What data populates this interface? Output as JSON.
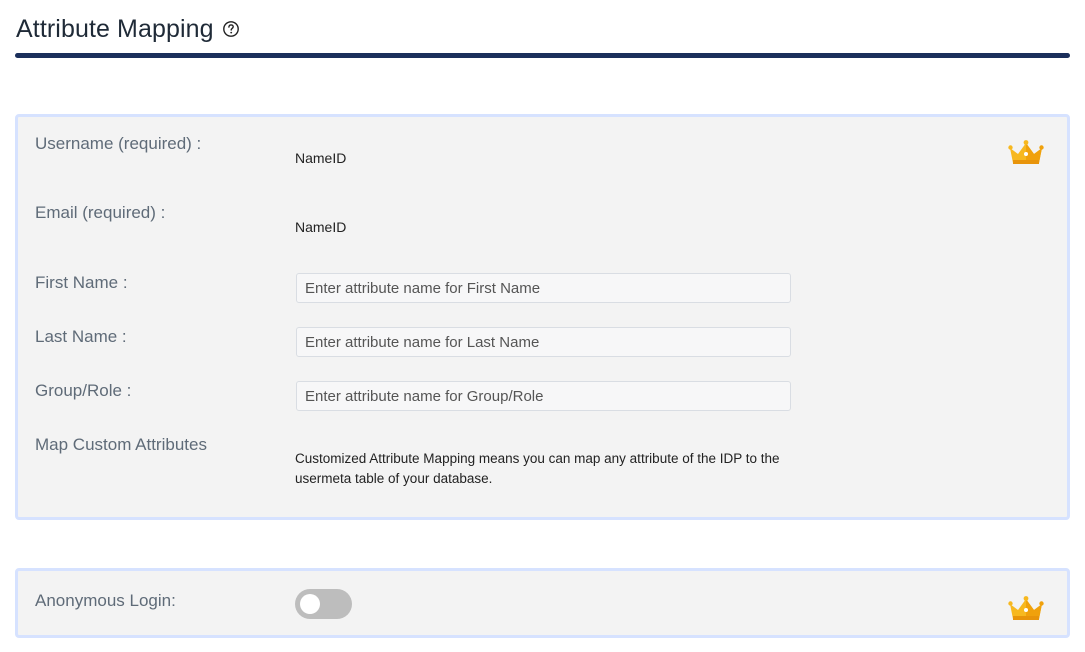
{
  "header": {
    "title": "Attribute Mapping",
    "help_icon": "question-circle-icon"
  },
  "mapping": {
    "premium_icon": "crown-icon",
    "username": {
      "label": "Username (required) :",
      "value": "NameID"
    },
    "email": {
      "label": "Email (required) :",
      "value": "NameID"
    },
    "first_name": {
      "label": "First Name :",
      "placeholder": "Enter attribute name for First Name",
      "value": ""
    },
    "last_name": {
      "label": "Last Name :",
      "placeholder": "Enter attribute name for Last Name",
      "value": ""
    },
    "group_role": {
      "label": "Group/Role :",
      "placeholder": "Enter attribute name for Group/Role",
      "value": ""
    },
    "custom": {
      "label": "Map Custom Attributes",
      "description": "Customized Attribute Mapping means you can map any attribute of the IDP to the usermeta table of your database."
    }
  },
  "anonymous": {
    "label": "Anonymous Login:",
    "enabled": false,
    "premium_icon": "crown-icon"
  },
  "colors": {
    "rule": "#1b2f5b",
    "card_bg": "#f3f3f3",
    "card_border": "#d6e2ff",
    "crown": "#f5b21b",
    "toggle_off": "#bdbdbd"
  }
}
